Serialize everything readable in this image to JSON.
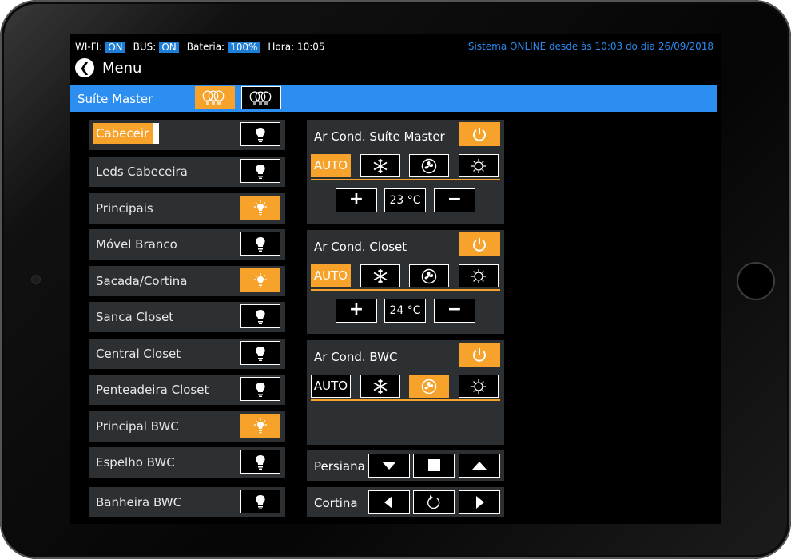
{
  "status": {
    "wifi_label": "WI-FI:",
    "wifi_value": "ON",
    "bus_label": "BUS:",
    "bus_value": "ON",
    "battery_label": "Bateria:",
    "battery_value": "100%",
    "time_label": "Hora:",
    "time_value": "10:05",
    "online_text": "Sistema ONLINE desde às 10:03 do dia 26/09/2018"
  },
  "header": {
    "back_icon": "arrow-left-circle-icon",
    "title": "Menu"
  },
  "room": {
    "name": "Suíte Master",
    "all_on_icon": "lightbulbs-on-icon",
    "all_off_icon": "lightbulbs-off-icon"
  },
  "lights": [
    {
      "label": "Cabeceir",
      "on": false,
      "editing": true
    },
    {
      "label": "Leds Cabeceira",
      "on": false
    },
    {
      "label": "Principais",
      "on": true
    },
    {
      "label": "Móvel Branco",
      "on": false
    },
    {
      "label": "Sacada/Cortina",
      "on": true
    },
    {
      "label": "Sanca Closet",
      "on": false
    },
    {
      "label": "Central Closet",
      "on": false
    },
    {
      "label": "Penteadeira Closet",
      "on": false
    },
    {
      "label": "Principal BWC",
      "on": true
    },
    {
      "label": "Espelho BWC",
      "on": false
    },
    {
      "label": "Banheira BWC",
      "on": false
    }
  ],
  "ac_units": [
    {
      "title": "Ar Cond. Suíte Master",
      "auto_label": "AUTO",
      "active_mode": "auto",
      "temperature": "23 °C",
      "plus": "+",
      "minus": "−"
    },
    {
      "title": "Ar Cond. Closet",
      "auto_label": "AUTO",
      "active_mode": "auto",
      "temperature": "24 °C",
      "plus": "+",
      "minus": "−"
    },
    {
      "title": "Ar Cond. BWC",
      "auto_label": "AUTO",
      "active_mode": "fan"
    }
  ],
  "persiana": {
    "label": "Persiana"
  },
  "cortina": {
    "label": "Cortina"
  },
  "colors": {
    "accent": "#f7a22b",
    "brand_blue": "#2b8ef0",
    "panel": "#2d3033"
  }
}
